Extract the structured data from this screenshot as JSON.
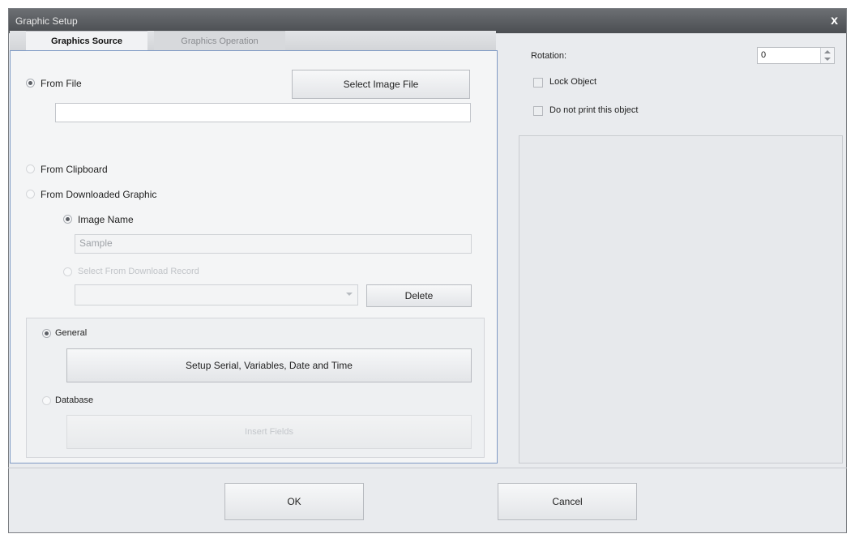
{
  "window": {
    "title": "Graphic Setup",
    "close_label": "x"
  },
  "tabs": [
    {
      "label": "Graphics Source",
      "active": true
    },
    {
      "label": "Graphics Operation",
      "active": false
    }
  ],
  "source": {
    "from_file": {
      "label": "From File",
      "checked": true
    },
    "select_image_button": "Select Image File",
    "file_path": "",
    "from_clipboard": {
      "label": "From Clipboard",
      "checked": false
    },
    "from_downloaded": {
      "label": "From Downloaded Graphic",
      "checked": false
    },
    "image_name": {
      "label": "Image Name",
      "checked": true,
      "value": "Sample"
    },
    "select_download_record": {
      "label": "Select From Download Record",
      "checked": false
    },
    "record_combo_value": "",
    "delete_button": "Delete"
  },
  "data_source": {
    "general": {
      "label": "General",
      "checked": true
    },
    "setup_button": "Setup Serial, Variables, Date and Time",
    "database": {
      "label": "Database",
      "checked": false
    },
    "insert_fields_button": "Insert Fields"
  },
  "properties": {
    "rotation_label": "Rotation:",
    "rotation_value": "0",
    "lock_object_label": "Lock Object",
    "lock_object_checked": false,
    "no_print_label": "Do not print this object",
    "no_print_checked": false
  },
  "footer": {
    "ok_label": "OK",
    "cancel_label": "Cancel"
  }
}
